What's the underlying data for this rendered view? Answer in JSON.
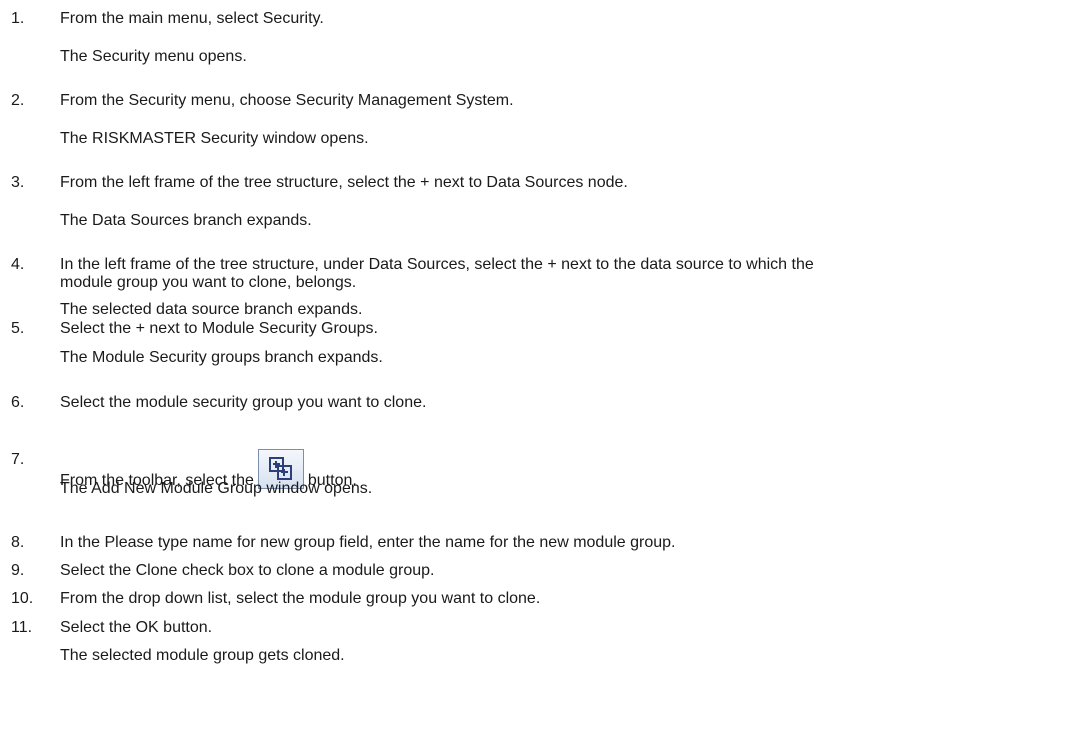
{
  "steps": [
    {
      "num": "1.",
      "text": "From the main menu, select Security.",
      "result": "The Security menu opens."
    },
    {
      "num": "2.",
      "text": "From the Security menu, choose Security Management System.",
      "result": "The RISKMASTER Security window opens."
    },
    {
      "num": "3.",
      "text": "From the left frame of the tree structure, select the + next to Data Sources node.",
      "result": "The Data Sources branch expands."
    },
    {
      "num": "4.",
      "text_line1": "In the left frame of the tree structure, under Data Sources, select the + next to the data source to which the",
      "text_line2": "module group you want to clone, belongs.",
      "result": "The selected data source branch expands."
    },
    {
      "num": "5.",
      "text": "Select the + next to Module Security Groups.",
      "result": "The Module Security groups branch expands."
    },
    {
      "num": "6.",
      "text": "Select the module security group you want to clone."
    },
    {
      "num": "7.",
      "text_before": "From the toolbar, select the",
      "icon": "clone-module-group-icon",
      "text_after": "button.",
      "result": "The Add New Module Group window opens."
    },
    {
      "num": "8.",
      "text": "In the Please type name for new group field, enter the name for the new module  group."
    },
    {
      "num": "9.",
      "text": "Select the Clone check box to clone a module group."
    },
    {
      "num": "10.",
      "text": "From the drop down list, select the module group you want to clone."
    },
    {
      "num": "11.",
      "text": "Select the OK button.",
      "result": "The selected module group gets cloned."
    }
  ]
}
